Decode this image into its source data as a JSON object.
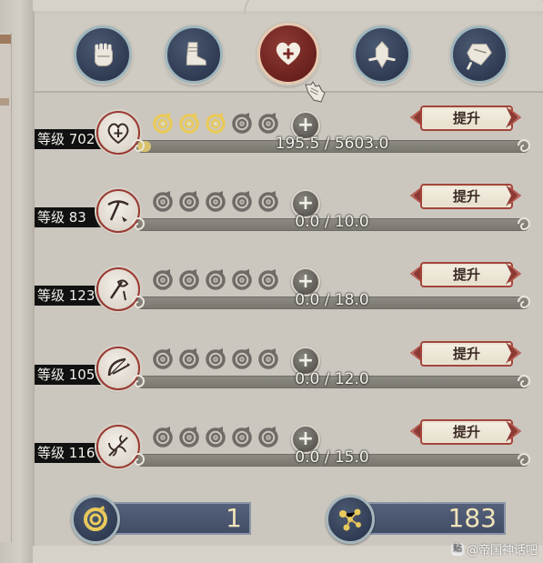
{
  "tabs": [
    {
      "icon": "fist-icon",
      "active": false
    },
    {
      "icon": "boot-icon",
      "active": false
    },
    {
      "icon": "heart-plus-icon",
      "active": true
    },
    {
      "icon": "hand-tools-icon",
      "active": false
    },
    {
      "icon": "scroll-banner-icon",
      "active": false
    }
  ],
  "skills": [
    {
      "level_label": "等级 702",
      "icon": "heart-plus-icon",
      "tokens_filled": 3,
      "tokens_total": 5,
      "progress_text": "195.5 / 5603.0",
      "progress_fraction": 0.035,
      "upgrade_label": "提升"
    },
    {
      "level_label": "等级 83",
      "icon": "pickaxe-icon",
      "tokens_filled": 0,
      "tokens_total": 5,
      "progress_text": "0.0 / 10.0",
      "progress_fraction": 0.0,
      "upgrade_label": "提升"
    },
    {
      "level_label": "等级 123",
      "icon": "axe-icon",
      "tokens_filled": 0,
      "tokens_total": 5,
      "progress_text": "0.0 / 18.0",
      "progress_fraction": 0.0,
      "upgrade_label": "提升"
    },
    {
      "level_label": "等级 105",
      "icon": "bow-icon",
      "tokens_filled": 0,
      "tokens_total": 5,
      "progress_text": "0.0 / 12.0",
      "progress_fraction": 0.0,
      "upgrade_label": "提升"
    },
    {
      "level_label": "等级 116",
      "icon": "herb-icon",
      "tokens_filled": 0,
      "tokens_total": 5,
      "progress_text": "0.0 / 15.0",
      "progress_fraction": 0.0,
      "upgrade_label": "提升"
    }
  ],
  "resources": {
    "token_count": "1",
    "orb_count": "183"
  },
  "watermark": "@帝国神话吧",
  "colors": {
    "accent_red": "#8e3a34",
    "token_gold": "#e8c95c",
    "token_grey": "#6f6b66",
    "navy": "#303c53"
  }
}
